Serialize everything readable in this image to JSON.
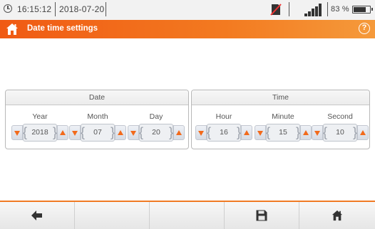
{
  "status_bar": {
    "time": "16:15:12",
    "date": "2018-07-20",
    "battery_percent": "83 %",
    "battery_level": 0.83,
    "icons": [
      "clock-icon",
      "no-sim-icon",
      "signal-icon",
      "battery-icon"
    ]
  },
  "title_bar": {
    "title": "Date time settings",
    "home_icon": "home-icon",
    "help_icon": "help-icon",
    "help_glyph": "?"
  },
  "date_panel": {
    "header": "Date",
    "fields": [
      {
        "label": "Year",
        "value": "2018"
      },
      {
        "label": "Month",
        "value": "07"
      },
      {
        "label": "Day",
        "value": "20"
      }
    ]
  },
  "time_panel": {
    "header": "Time",
    "fields": [
      {
        "label": "Hour",
        "value": "16"
      },
      {
        "label": "Minute",
        "value": "15"
      },
      {
        "label": "Second",
        "value": "10"
      }
    ]
  },
  "bottom_bar": {
    "buttons": [
      {
        "icon": "back-arrow-icon"
      },
      {
        "icon": ""
      },
      {
        "icon": ""
      },
      {
        "icon": "save-icon"
      },
      {
        "icon": "home-icon"
      }
    ]
  },
  "colors": {
    "accent": "#f26a1b",
    "title_bar": "#f05a14",
    "status_bar": "#f2f2f2"
  }
}
